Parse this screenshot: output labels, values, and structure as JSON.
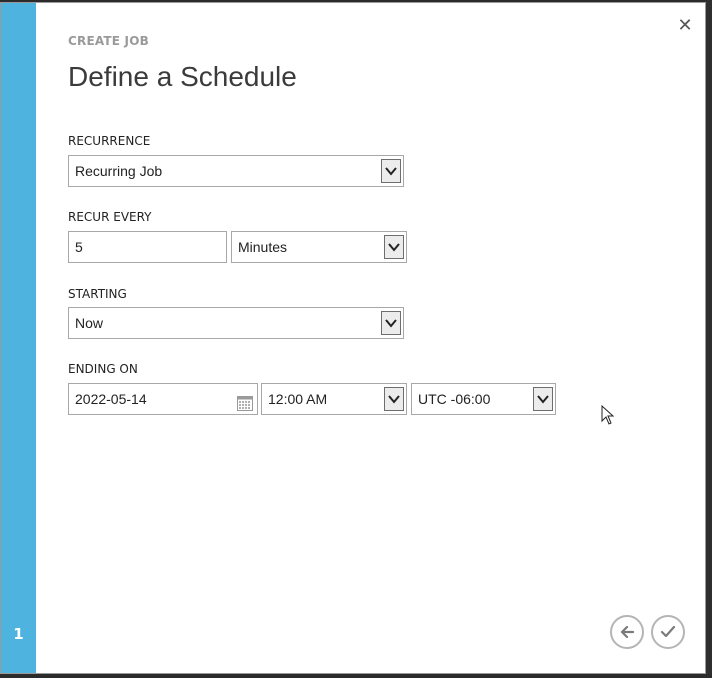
{
  "step": {
    "number": "1"
  },
  "header": {
    "eyebrow": "CREATE JOB",
    "title": "Define a Schedule"
  },
  "recurrence": {
    "label": "RECURRENCE",
    "value": "Recurring Job"
  },
  "recur_every": {
    "label": "RECUR EVERY",
    "value": "5",
    "unit": "Minutes"
  },
  "starting": {
    "label": "STARTING",
    "value": "Now"
  },
  "ending_on": {
    "label": "ENDING ON",
    "date": "2022-05-14",
    "time": "12:00 AM",
    "timezone": "UTC -06:00"
  },
  "icons": {
    "close": "close-icon",
    "calendar": "calendar-icon",
    "back": "back-arrow-icon",
    "confirm": "checkmark-icon",
    "dropdown": "chevron-down-icon"
  },
  "colors": {
    "accent": "#4fb3e0",
    "text": "#3b3b3b",
    "muted": "#9a9a9a"
  }
}
